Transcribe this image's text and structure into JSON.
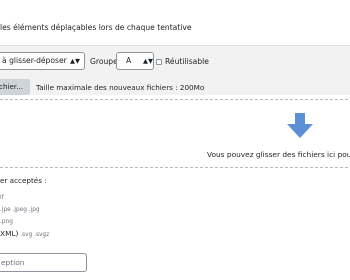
{
  "settings": {
    "shuffle_text": "les éléments déplaçables lors de chaque tentative"
  },
  "drag_item": {
    "type_value": "à glisser-déposer",
    "group_label": "Groupe",
    "group_value": "A",
    "reusable_label": "Réutilisable",
    "reusable_checked": false
  },
  "file_picker": {
    "button_label": "chier...",
    "max_size_text": "Taille maximale des nouveaux fichiers : 200Mo"
  },
  "dropzone": {
    "text": "Vous pouvez glisser des fichiers ici pour",
    "arrow_color": "#5b8fd6"
  },
  "accepted_types": {
    "title": "er acceptés :",
    "lines": [
      "if",
      ".jpe .jpeg .jpg",
      ".png"
    ],
    "last_line_label": "XML)",
    "last_line_ext": ".svg .svgz"
  },
  "caption_input": {
    "value": "eption"
  },
  "icons": {
    "caret": "caret-updown-icon",
    "drop": "download-arrow-icon",
    "checkbox": "checkbox-icon"
  }
}
